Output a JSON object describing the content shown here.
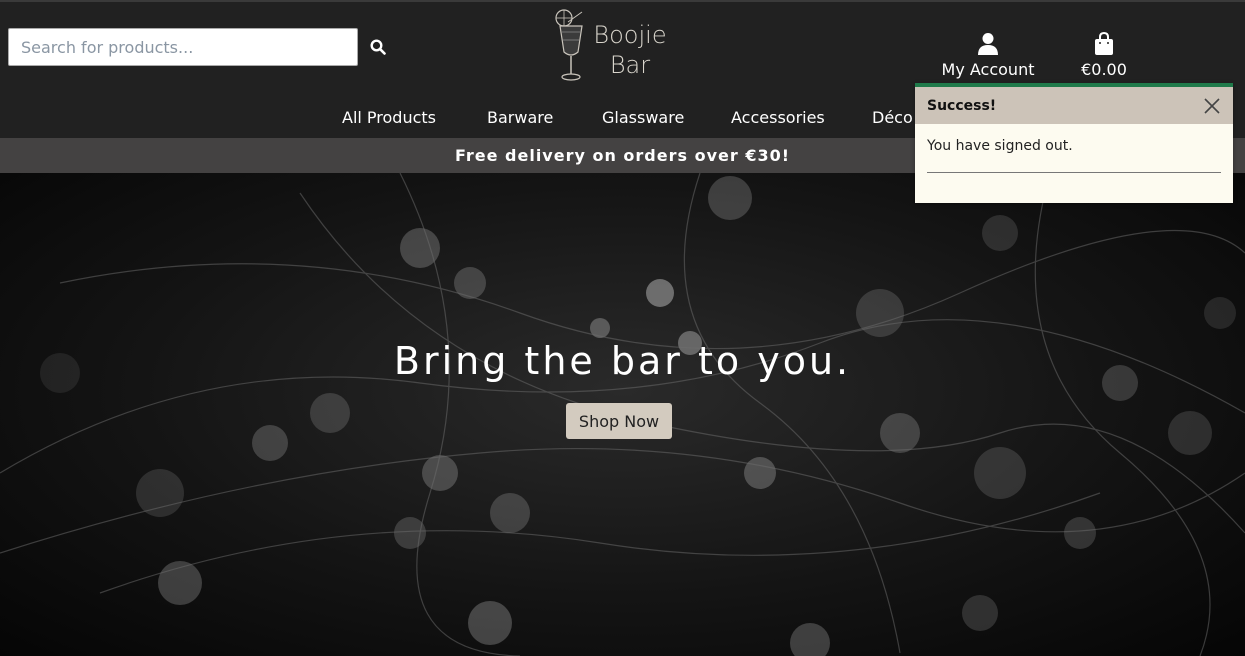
{
  "search": {
    "placeholder": "Search for products..."
  },
  "logo": {
    "line1": "Boojie",
    "line2": "Bar"
  },
  "account": {
    "label": "My Account"
  },
  "cart": {
    "total": "€0.00"
  },
  "nav": {
    "items": [
      {
        "label": "All Products"
      },
      {
        "label": "Barware"
      },
      {
        "label": "Glassware"
      },
      {
        "label": "Accessories"
      },
      {
        "label": "Déco"
      }
    ]
  },
  "banner": {
    "text": "Free delivery on orders over €30!"
  },
  "hero": {
    "title": "Bring the bar to you.",
    "button": "Shop Now"
  },
  "toast": {
    "title": "Success!",
    "message": "You have signed out."
  },
  "colors": {
    "header_bg": "#212121",
    "banner_bg": "#444242",
    "button_bg": "#d3cbbf",
    "toast_accent": "#1f7a4a",
    "toast_header_bg": "#ccc3b8"
  }
}
